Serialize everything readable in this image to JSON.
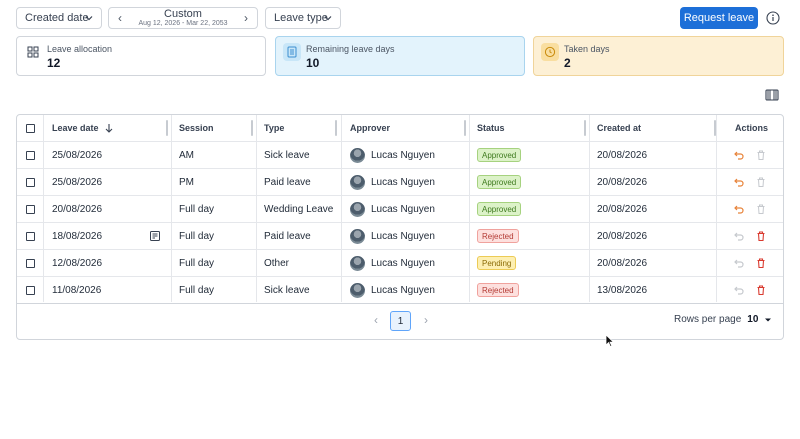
{
  "toolbar": {
    "sort_label": "Created date",
    "range_label": "Custom",
    "range_sub": "Aug 12, 2026 - Mar 22, 2053",
    "type_label": "Leave type",
    "request_label": "Request leave"
  },
  "stats": [
    {
      "title": "Leave allocation",
      "value": "12",
      "icon": "grid-icon"
    },
    {
      "title": "Remaining leave days",
      "value": "10",
      "icon": "list-icon"
    },
    {
      "title": "Taken days",
      "value": "2",
      "icon": "clock-icon"
    }
  ],
  "table": {
    "headers": {
      "leave_date": "Leave date",
      "session": "Session",
      "type": "Type",
      "approver": "Approver",
      "status": "Status",
      "created_at": "Created at",
      "actions": "Actions"
    },
    "rows": [
      {
        "leave_date": "25/08/2026",
        "session": "AM",
        "type": "Sick leave",
        "approver": "Lucas Nguyen",
        "status": "Approved",
        "created_at": "20/08/2026"
      },
      {
        "leave_date": "25/08/2026",
        "session": "PM",
        "type": "Paid leave",
        "approver": "Lucas Nguyen",
        "status": "Approved",
        "created_at": "20/08/2026"
      },
      {
        "leave_date": "20/08/2026",
        "session": "Full day",
        "type": "Wedding Leave",
        "approver": "Lucas Nguyen",
        "status": "Approved",
        "created_at": "20/08/2026"
      },
      {
        "leave_date": "18/08/2026",
        "session": "Full day",
        "type": "Paid leave",
        "approver": "Lucas Nguyen",
        "status": "Rejected",
        "created_at": "20/08/2026"
      },
      {
        "leave_date": "12/08/2026",
        "session": "Full day",
        "type": "Other",
        "approver": "Lucas Nguyen",
        "status": "Pending",
        "created_at": "20/08/2026"
      },
      {
        "leave_date": "11/08/2026",
        "session": "Full day",
        "type": "Sick leave",
        "approver": "Lucas Nguyen",
        "status": "Rejected",
        "created_at": "13/08/2026"
      }
    ]
  },
  "pagination": {
    "current_page": "1",
    "rows_per_page_label": "Rows per page",
    "rows_per_page_value": "10"
  },
  "colors": {
    "primary": "#1d6fd8",
    "approved": "#dcf2c8",
    "rejected": "#fde0de",
    "pending": "#fdefb2",
    "revert_active": "#e8833a",
    "delete_active": "#d93a2f"
  }
}
